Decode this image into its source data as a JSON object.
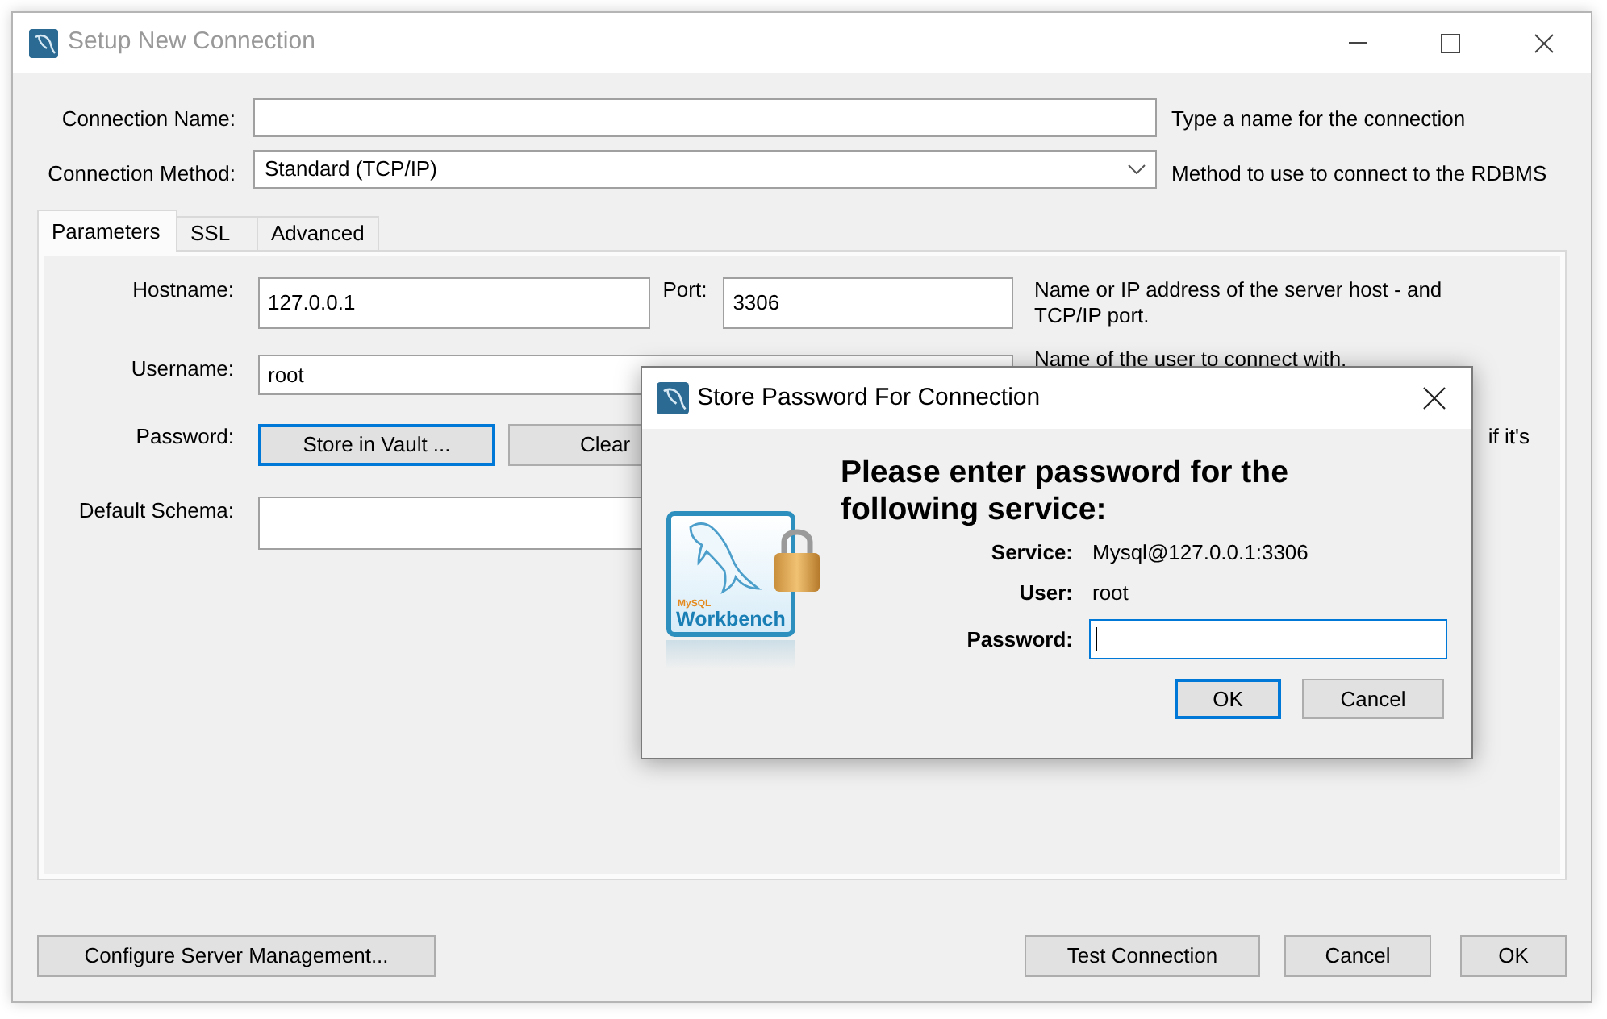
{
  "window": {
    "title": "Setup New Connection"
  },
  "connection_name": {
    "label": "Connection Name:",
    "hint": "Type a name for the connection"
  },
  "connection_method": {
    "label": "Connection Method:",
    "value": "Standard (TCP/IP)",
    "hint": "Method to use to connect to the RDBMS"
  },
  "tabs": [
    {
      "label": "Parameters",
      "selected": true
    },
    {
      "label": "SSL",
      "selected": false
    },
    {
      "label": "Advanced",
      "selected": false
    }
  ],
  "parameters": {
    "hostname": {
      "label": "Hostname:",
      "value": "127.0.0.1"
    },
    "port": {
      "label": "Port:",
      "value": "3306"
    },
    "host_hint": "Name or IP address of the server host - and TCP/IP port.",
    "username": {
      "label": "Username:",
      "value": "root",
      "hint": "Name of the user to connect with."
    },
    "password": {
      "label": "Password:",
      "buttons": [
        {
          "label": "Store in Vault ...",
          "focused": true
        },
        {
          "label": "Clear",
          "focused": false
        }
      ],
      "hint": "if it's"
    },
    "default_schema": {
      "label": "Default Schema:"
    }
  },
  "footer": {
    "left_buttons": [
      "Configure Server Management..."
    ],
    "right_buttons": [
      "Test Connection",
      "Cancel",
      "OK"
    ]
  },
  "password_dialog": {
    "title": "Store Password For Connection",
    "logo": {
      "brand": "MySQL",
      "product": "Workbench"
    },
    "heading": "Please enter password for the following service:",
    "details": [
      {
        "label": "Service:",
        "value": "Mysql@127.0.0.1:3306"
      },
      {
        "label": "User:",
        "value": "root"
      }
    ],
    "password": {
      "label": "Password:",
      "focused": true
    },
    "buttons": [
      {
        "label": "OK",
        "default": true
      },
      {
        "label": "Cancel",
        "default": false
      }
    ]
  }
}
